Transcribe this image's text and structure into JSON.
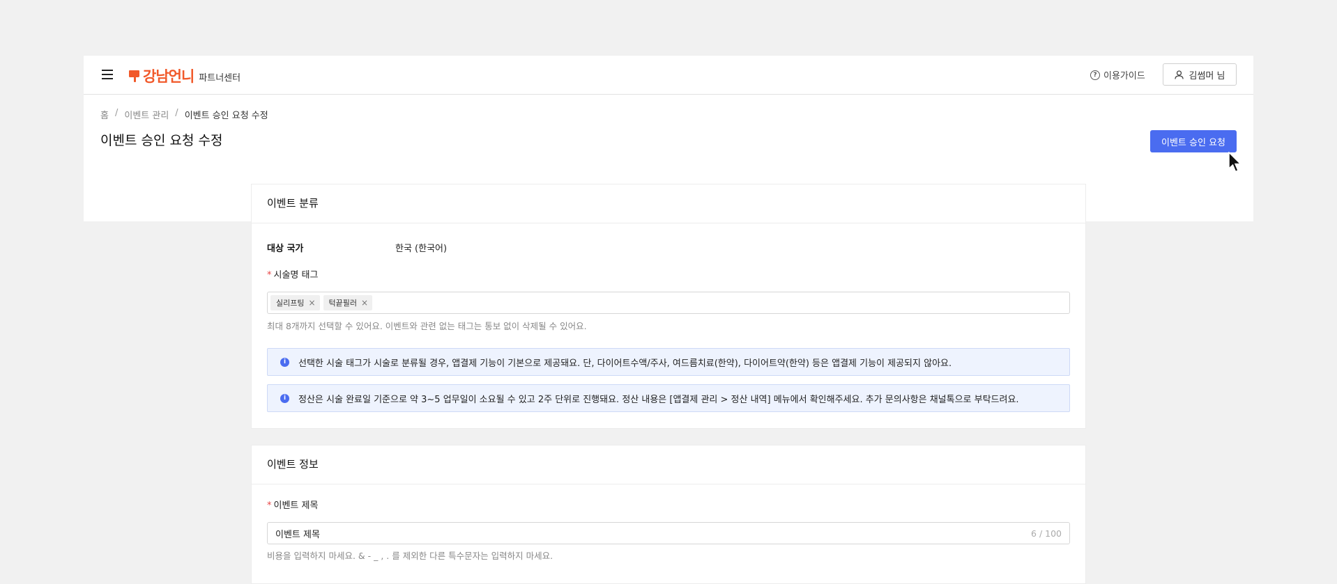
{
  "header": {
    "brand": "강남언니",
    "brand_sub": "파트너센터",
    "guide_label": "이용가이드",
    "user_label": "김썸머 님",
    "brand_color": "#f1592a"
  },
  "breadcrumb": [
    "홈",
    "이벤트 관리",
    "이벤트 승인 요청 수정"
  ],
  "page": {
    "title": "이벤트 승인 요청 수정",
    "primary_button": "이벤트 승인 요청",
    "accent_color": "#4a6cf0"
  },
  "category_section": {
    "title": "이벤트 분류",
    "country_label": "대상 국가",
    "country_value": "한국 (한국어)",
    "tag_label": "시술명 태그",
    "tags": [
      "실리프팅",
      "턱끝필러"
    ],
    "tag_hint": "최대 8개까지 선택할 수 있어요. 이벤트와 관련 없는 태그는 통보 없이 삭제될 수 있어요.",
    "notices": [
      "선택한 시술 태그가 시술로 분류될 경우, 앱결제 기능이 기본으로 제공돼요. 단, 다이어트수액/주사, 여드름치료(한약), 다이어트약(한약) 등은 앱결제 기능이 제공되지 않아요.",
      "정산은 시술 완료일 기준으로 약 3~5 업무일이 소요될 수 있고 2주 단위로 진행돼요. 정산 내용은 [앱결제 관리 > 정산 내역] 메뉴에서 확인해주세요. 추가 문의사항은 채널톡으로 부탁드려요."
    ]
  },
  "info_section": {
    "title": "이벤트 정보",
    "event_title_label": "이벤트 제목",
    "event_title_value": "이벤트 제목",
    "event_title_count": "6 / 100",
    "event_title_hint": "비용을 입력하지 마세요. & - _ , . 를 제외한 다른 특수문자는 입력하지 마세요."
  }
}
